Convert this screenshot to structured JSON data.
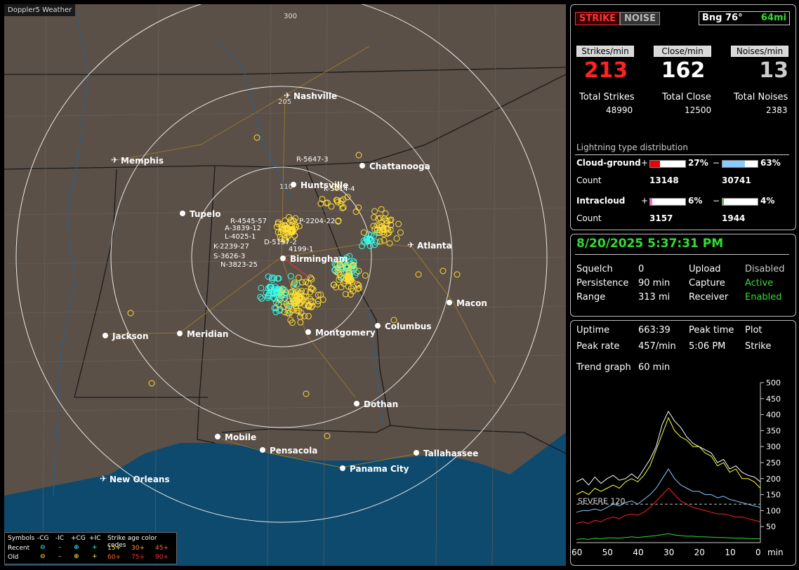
{
  "app_title": "Doppler5 Weather",
  "map": {
    "cities": [
      {
        "name": "Nashville",
        "airport": true
      },
      {
        "name": "Memphis",
        "airport": true
      },
      {
        "name": "Chattanooga",
        "airport": false
      },
      {
        "name": "Huntsville",
        "airport": false
      },
      {
        "name": "Tupelo",
        "airport": false
      },
      {
        "name": "Birmingham",
        "airport": false
      },
      {
        "name": "Atlanta",
        "airport": true
      },
      {
        "name": "Macon",
        "airport": false
      },
      {
        "name": "Jackson",
        "airport": false
      },
      {
        "name": "Meridian",
        "airport": false
      },
      {
        "name": "Montgomery",
        "airport": false
      },
      {
        "name": "Columbus",
        "airport": false
      },
      {
        "name": "Dothan",
        "airport": false
      },
      {
        "name": "Mobile",
        "airport": false
      },
      {
        "name": "Pensacola",
        "airport": false
      },
      {
        "name": "Tallahassee",
        "airport": false
      },
      {
        "name": "Panama City",
        "airport": false
      },
      {
        "name": "New Orleans",
        "airport": true
      }
    ],
    "range_labels": [
      "300",
      "205",
      "110"
    ],
    "strike_labels": [
      "R-5647-3",
      "K-5014-4",
      "R-4545-57",
      "A-3839-12",
      "L-4025-1",
      "P-2204-22",
      "D-5197-2",
      "K-2239-27",
      "4199-1",
      "S-3626-3",
      "N-3823-25"
    ]
  },
  "legend": {
    "symbols_label": "Symbols",
    "cols": [
      "-CG",
      "-IC",
      "+CG",
      "+IC"
    ],
    "age_label": "Strike age color codes",
    "recent_label": "Recent",
    "old_label": "Old",
    "recent_ages": [
      "15+",
      "30+",
      "45+"
    ],
    "old_ages": [
      "60+",
      "75+",
      "90+"
    ],
    "recent_colors": [
      "#ffee33",
      "#ff9933",
      "#ff6633"
    ],
    "old_colors": [
      "#ff3333",
      "#ff3333",
      "#ff3333"
    ]
  },
  "status": {
    "strike_button": "STRIKE",
    "noise_button": "NOISE",
    "bearing": "Bng 76°",
    "distance": "64mi",
    "strikes_min_label": "Strikes/min",
    "close_min_label": "Close/min",
    "noises_min_label": "Noises/min",
    "strikes_min": "213",
    "close_min": "162",
    "noises_min": "13",
    "total_strikes_label": "Total Strikes",
    "total_close_label": "Total Close",
    "total_noises_label": "Total Noises",
    "total_strikes": "48990",
    "total_close": "12500",
    "total_noises": "2383",
    "distribution_title": "Lightning type distribution",
    "cg_label": "Cloud-ground",
    "ic_label": "Intracloud",
    "count_label": "Count",
    "plus": "+",
    "minus": "−",
    "cg_pos_pct": "27%",
    "cg_neg_pct": "63%",
    "ic_pos_pct": "6%",
    "ic_neg_pct": "4%",
    "cg_pos_count": "13148",
    "cg_neg_count": "30741",
    "ic_pos_count": "3157",
    "ic_neg_count": "1944",
    "cg_pos_frac": 0.27,
    "cg_neg_frac": 0.63,
    "ic_pos_frac": 0.06,
    "ic_neg_frac": 0.04
  },
  "settings": {
    "datetime": "8/20/2025 5:37:31 PM",
    "squelch_label": "Squelch",
    "squelch": "0",
    "persistence_label": "Persistence",
    "persistence": "90 min",
    "range_label": "Range",
    "range": "313 mi",
    "upload_label": "Upload",
    "upload": "Disabled",
    "capture_label": "Capture",
    "capture": "Active",
    "receiver_label": "Receiver",
    "receiver": "Enabled"
  },
  "trend": {
    "uptime_label": "Uptime",
    "uptime": "663:39",
    "peak_time_label": "Peak time",
    "peak_time": "5:06 PM",
    "plot_label": "Plot",
    "plot": "Strike",
    "peak_rate_label": "Peak rate",
    "peak_rate": "457/min",
    "trend_graph_label": "Trend graph",
    "trend_graph": "60 min",
    "severe_label": "SEVERE 120"
  },
  "chart_data": {
    "type": "line",
    "x_ticks": [
      "60",
      "50",
      "40",
      "30",
      "20",
      "10",
      "0"
    ],
    "x_unit": "min",
    "y_ticks": [
      "500",
      "450",
      "400",
      "350",
      "300",
      "250",
      "200",
      "150",
      "100",
      "50"
    ],
    "ylim": [
      0,
      500
    ],
    "xlim": [
      60,
      0
    ],
    "severe_threshold": 120,
    "series": [
      {
        "color": "#ffffff",
        "values": [
          190,
          200,
          180,
          205,
          185,
          200,
          210,
          195,
          200,
          215,
          200,
          230,
          260,
          300,
          370,
          410,
          380,
          360,
          330,
          310,
          300,
          290,
          280,
          250,
          260,
          230,
          240,
          220,
          210,
          205,
          190
        ]
      },
      {
        "color": "#ffff33",
        "values": [
          150,
          160,
          150,
          170,
          160,
          170,
          180,
          170,
          190,
          200,
          190,
          210,
          240,
          290,
          340,
          390,
          350,
          330,
          320,
          300,
          300,
          280,
          270,
          240,
          250,
          220,
          230,
          200,
          200,
          190,
          170
        ]
      },
      {
        "color": "#88ccff",
        "values": [
          95,
          100,
          100,
          105,
          100,
          110,
          120,
          115,
          125,
          130,
          120,
          135,
          150,
          170,
          200,
          230,
          200,
          180,
          170,
          160,
          160,
          150,
          150,
          140,
          145,
          135,
          130,
          125,
          120,
          115,
          110
        ]
      },
      {
        "color": "#ff2222",
        "values": [
          60,
          65,
          60,
          70,
          65,
          75,
          80,
          75,
          85,
          90,
          85,
          95,
          110,
          130,
          150,
          170,
          150,
          130,
          120,
          110,
          105,
          100,
          95,
          90,
          90,
          85,
          80,
          80,
          75,
          70,
          65
        ]
      },
      {
        "color": "#33dd33",
        "values": [
          10,
          12,
          10,
          14,
          12,
          15,
          15,
          14,
          16,
          18,
          16,
          18,
          20,
          22,
          25,
          28,
          24,
          22,
          20,
          20,
          18,
          18,
          17,
          16,
          16,
          15,
          14,
          14,
          13,
          12,
          12
        ]
      }
    ]
  }
}
